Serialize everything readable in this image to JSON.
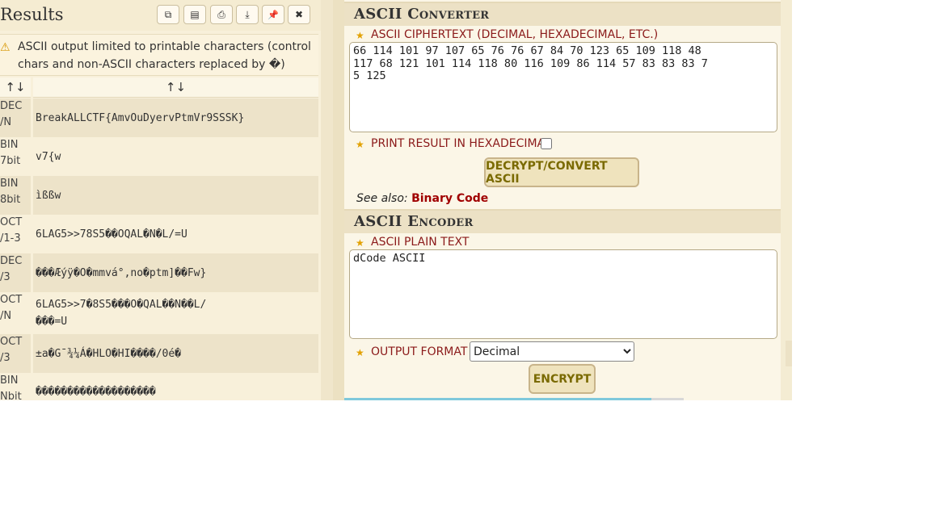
{
  "results": {
    "title": "Results",
    "toolbar": [
      {
        "name": "copy-icon",
        "glyph": "⧉"
      },
      {
        "name": "clipboard-icon",
        "glyph": "▤"
      },
      {
        "name": "print-icon",
        "glyph": "⎙"
      },
      {
        "name": "download-icon",
        "glyph": "⤓"
      },
      {
        "name": "pin-icon",
        "glyph": "📌"
      },
      {
        "name": "close-icon",
        "glyph": "✖"
      }
    ],
    "warning_icon": "⚠",
    "warning": "ASCII output limited to printable characters (control chars and non-ASCII characters replaced by �)",
    "sort_col1": "↑↓",
    "sort_col2": "↑↓",
    "rows": [
      {
        "type": "DEC\n/N",
        "value": "BreakALLCTF{AmvOuDyervPtmVr9SSSK}"
      },
      {
        "type": "BIN\n7bit",
        "value": "v7{w"
      },
      {
        "type": "BIN\n8bit",
        "value": "ìßßw"
      },
      {
        "type": "OCT\n/1-3",
        "value": "6LAG5>>78S5��OQAL�N�L/=U"
      },
      {
        "type": "DEC\n/3",
        "value": "���Æýÿ�O�mmvá°,no�ptm]��Fw}"
      },
      {
        "type": "OCT\n/N",
        "value": "6LAG5>>7�8S5���O�QAL��N��L/\n���=U"
      },
      {
        "type": "OCT\n/3",
        "value": "±a�G¯¾¼Á�HLO�HI����/0é�"
      },
      {
        "type": "BIN\nNbit",
        "value": "�������������������"
      }
    ]
  },
  "converter": {
    "title": "ASCII Converter",
    "ciphertext_label": "ASCII CIPHERTEXT (DECIMAL, HEXADECIMAL, ETC.)",
    "ciphertext_value": "66 114 101 97 107 65 76 76 67 84 70 123 65 109 118 48\n117 68 121 101 114 118 80 116 109 86 114 57 83 83 83 7\n5 125",
    "hex_label": "PRINT RESULT IN HEXADECIMAL",
    "hex_checked": false,
    "decrypt_button": "DECRYPT/CONVERT ASCII",
    "see_also_label": "See also:",
    "see_also_link": "Binary Code"
  },
  "encoder": {
    "title": "ASCII Encoder",
    "plaintext_label": "ASCII PLAIN TEXT",
    "plaintext_value": "dCode ASCII",
    "format_label": "OUTPUT FORMAT",
    "format_selected": "Decimal",
    "encrypt_button": "ENCRYPT"
  }
}
